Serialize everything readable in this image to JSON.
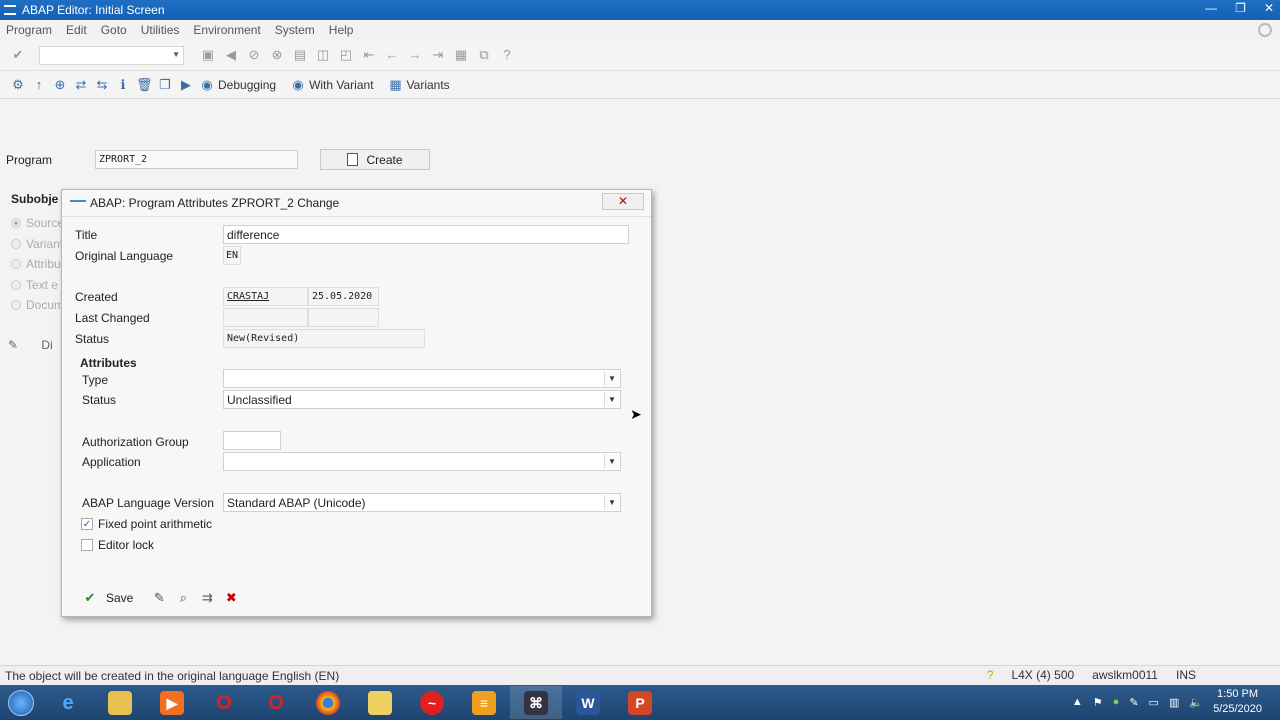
{
  "window": {
    "title": "ABAP Editor: Initial Screen",
    "controls": [
      "—",
      "❐",
      "✕"
    ]
  },
  "menu": [
    "Program",
    "Edit",
    "Goto",
    "Utilities",
    "Environment",
    "System",
    "Help"
  ],
  "app_toolbar": {
    "buttons": [
      {
        "label": "Debugging",
        "icon": "debug-icon"
      },
      {
        "label": "With Variant",
        "icon": "execute-variant-icon"
      },
      {
        "label": "Variants",
        "icon": "variants-icon"
      }
    ]
  },
  "main": {
    "program_label": "Program",
    "program_value": "ZPRORT_2",
    "create_label": "Create",
    "subobjects_title": "Subobje",
    "subobjects": [
      "Source",
      "Variant",
      "Attribu",
      "Text e",
      "Docum"
    ],
    "display_label": "Di"
  },
  "dialog": {
    "title": "ABAP: Program Attributes ZPRORT_2 Change",
    "close": "✕",
    "title_label": "Title",
    "title_value": "difference",
    "orig_lang_label": "Original Language",
    "orig_lang_value": "EN",
    "created_label": "Created",
    "created_by": "CRASTAJ",
    "created_on": "25.05.2020",
    "last_changed_label": "Last Changed",
    "status_label": "Status",
    "status_value": "New(Revised)",
    "attributes_title": "Attributes",
    "type_label": "Type",
    "type_value": "",
    "attr_status_label": "Status",
    "attr_status_value": "Unclassified",
    "auth_group_label": "Authorization Group",
    "application_label": "Application",
    "application_value": "",
    "lang_version_label": "ABAP Language Version",
    "lang_version_value": "Standard ABAP (Unicode)",
    "fixed_point_label": "Fixed point arithmetic",
    "fixed_point_checked": true,
    "editor_lock_label": "Editor lock",
    "editor_lock_checked": false,
    "save_label": "Save"
  },
  "status_bar": {
    "message": "The object will be created in the original language English (EN)",
    "system": "L4X (4) 500",
    "server": "awslkm0011",
    "mode": "INS"
  },
  "taskbar": {
    "time": "1:50 PM",
    "date": "5/25/2020"
  }
}
